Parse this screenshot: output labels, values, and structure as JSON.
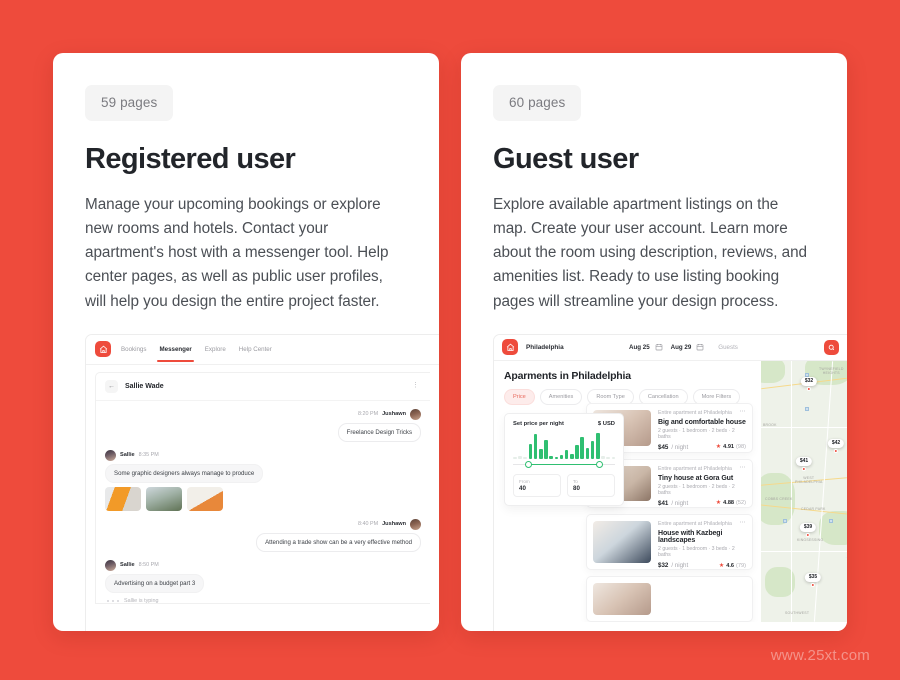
{
  "page": {
    "background_color": "#ee4b3c",
    "accent_color": "#ee4b3c",
    "watermark": "www.25xt.com"
  },
  "cards": [
    {
      "badge": "59 pages",
      "title": "Registered user",
      "description": "Manage your upcoming bookings or explore new rooms and hotels. Contact your apartment's host with a messenger tool. Help center pages, as well as public user profiles, will help you design the entire project faster."
    },
    {
      "badge": "60 pages",
      "title": "Guest user",
      "description": "Explore available apartment listings on the map. Create your user account. Learn more about the room using description, reviews, and amenities list. Ready to use listing booking pages will streamline your design process."
    }
  ],
  "messenger_mock": {
    "nav": {
      "logo_icon": "house-icon",
      "tabs": [
        {
          "label": "Bookings",
          "active": false
        },
        {
          "label": "Messenger",
          "active": true
        },
        {
          "label": "Explore",
          "active": false
        },
        {
          "label": "Help Center",
          "active": false
        }
      ]
    },
    "chat": {
      "back_icon": "arrow-left-icon",
      "title": "Sallie Wade",
      "more_icon": "more-vertical-icon",
      "messages": [
        {
          "side": "out",
          "time": "8:20 PM",
          "author": "Jushawn",
          "text": "Freelance Design Tricks"
        },
        {
          "side": "in",
          "author": "Sallie",
          "time": "8:35 PM",
          "text": "Some graphic designers always manage to produce",
          "attachments": [
            "photo-1",
            "photo-2",
            "photo-3"
          ]
        },
        {
          "side": "out",
          "time": "8:40 PM",
          "author": "Jushawn",
          "text": "Attending a trade show can be a very effective method"
        },
        {
          "side": "in",
          "author": "Sallie",
          "time": "8:50 PM",
          "text": "Advertising on a budget part 3"
        }
      ],
      "typing_status": "Sallie is typing"
    }
  },
  "listing_mock": {
    "nav": {
      "logo_icon": "house-icon",
      "city": "Philadelphia",
      "check_in": "Aug 25",
      "check_out": "Aug 29",
      "calendar_icon": "calendar-icon",
      "guests_placeholder": "Guests",
      "search_icon": "search-icon"
    },
    "heading": "Aparments in Philadelphia",
    "filters": [
      {
        "label": "Price",
        "active": true
      },
      {
        "label": "Amenities",
        "active": false
      },
      {
        "label": "Room Type",
        "active": false
      },
      {
        "label": "Cancellation",
        "active": false
      },
      {
        "label": "More Filters",
        "active": false
      }
    ],
    "price_panel": {
      "title": "Set price per night",
      "currency": "$ USD",
      "from_label": "From",
      "from_value": "40",
      "to_label": "To",
      "to_value": "80",
      "histogram": [
        8,
        12,
        6,
        58,
        96,
        40,
        72,
        10,
        6,
        14,
        34,
        18,
        52,
        86,
        44,
        70,
        100,
        12,
        8,
        6
      ],
      "histogram_active_from": 3,
      "histogram_active_to": 16,
      "bar_color": "#2fbf71"
    },
    "listings": [
      {
        "subtitle": "Entire apartment at Philadelphia",
        "title": "Big and comfortable house",
        "specs": "2 guests · 1 bedroom · 2 beds · 2 baths",
        "price": "$45",
        "price_unit": "/ night",
        "rating": "4.91",
        "reviews": "(98)",
        "more_icon": "more-horizontal-icon"
      },
      {
        "subtitle": "Entire apartment at Philadelphia",
        "title": "Tiny house at Gora Gut",
        "specs": "2 guests · 1 bedroom · 2 beds · 2 baths",
        "price": "$41",
        "price_unit": "/ night",
        "rating": "4.88",
        "reviews": "(52)",
        "more_icon": "more-horizontal-icon"
      },
      {
        "subtitle": "Entire apartment at Philadelphia",
        "title": "House with Kazbegi landscapes",
        "specs": "2 guests · 1 bedroom · 3 beds · 2 baths",
        "price": "$32",
        "price_unit": "/ night",
        "rating": "4.6",
        "reviews": "(79)",
        "more_icon": "more-horizontal-icon"
      }
    ],
    "map": {
      "pins": [
        "$32",
        "$42",
        "$41",
        "$39",
        "$35"
      ],
      "labels": [
        "TWYNEFIELD\nHEIGHTS",
        "BROOK",
        "WEST\nPHILADELPHIA",
        "COBBS CREEK",
        "CEDAR PARK",
        "KINGSESSING",
        "SOUTHWEST"
      ]
    }
  }
}
